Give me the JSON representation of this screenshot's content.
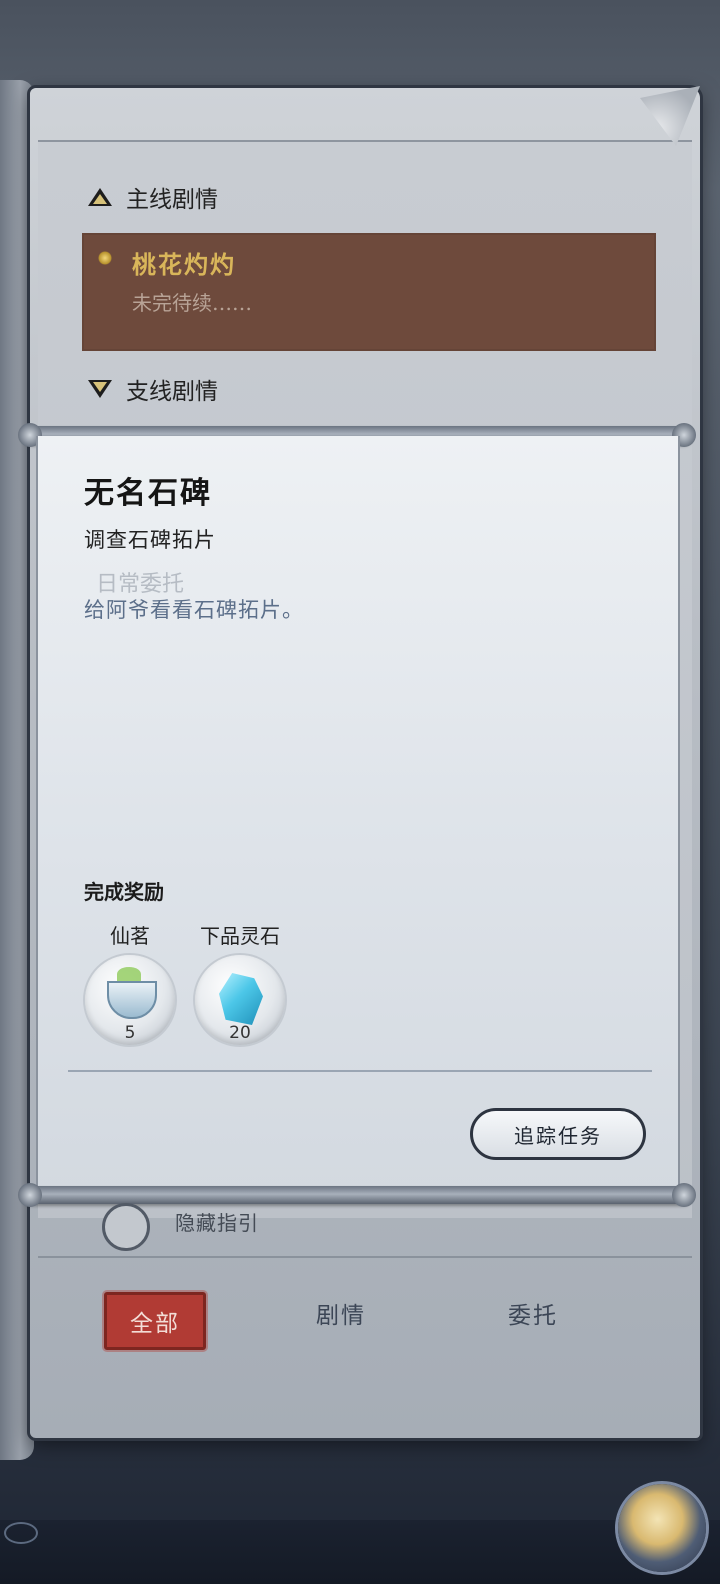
{
  "quest_log": {
    "main_header": "主线剧情",
    "main_quest": {
      "title": "桃花灼灼",
      "subtitle": "未完待续……"
    },
    "side_header": "支线剧情",
    "ghost_daily": "日常委托"
  },
  "detail": {
    "title": "无名石碑",
    "subtitle": "调查石碑拓片",
    "description": "给阿爷看看石碑拓片。",
    "reward_heading": "完成奖励",
    "rewards": [
      {
        "name": "仙茗",
        "count": "5",
        "icon": "tea-cup-icon"
      },
      {
        "name": "下品灵石",
        "count": "20",
        "icon": "spirit-stone-icon"
      }
    ],
    "track_button": "追踪任务"
  },
  "hide_guide_label": "隐藏指引",
  "tabs": {
    "all": "全部",
    "story": "剧情",
    "commission": "委托"
  },
  "colors": {
    "selected_row": "#6e4a3c",
    "selected_title": "#d9b65a",
    "active_tab": "#b13b34"
  }
}
